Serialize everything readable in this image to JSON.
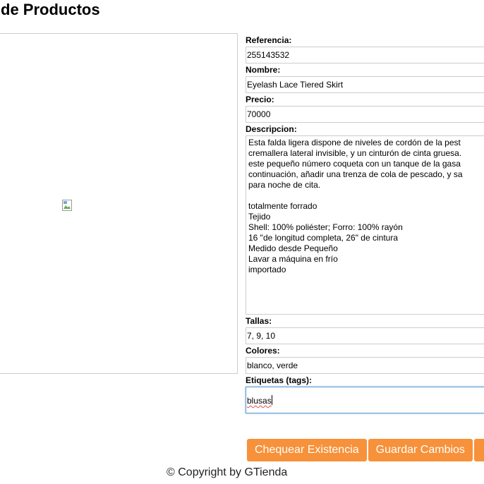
{
  "page": {
    "title": "de Productos"
  },
  "image_panel": {
    "icon": "broken-image-icon"
  },
  "form": {
    "referencia": {
      "label": "Referencia:",
      "value": "255143532"
    },
    "nombre": {
      "label": "Nombre:",
      "value": "Eyelash Lace Tiered Skirt"
    },
    "precio": {
      "label": "Precio:",
      "value": "70000"
    },
    "descripcion": {
      "label": "Descripcion:",
      "value": "Esta falda ligera dispone de niveles de cordón de la pest\ncremallera lateral invisible, y un cinturón de cinta gruesa.\neste pequeño número coqueta con un tanque de la gasa\ncontinuación, añadir una trenza de cola de pescado, y sa\npara noche de cita.\n\ntotalmente forrado\nTejido\nShell: 100% poliéster; Forro: 100% rayón\n16 \"de longitud completa, 26\" de cintura\nMedido desde Pequeño\nLavar a máquina en frío\nimportado"
    },
    "tallas": {
      "label": "Tallas:",
      "value": "7, 9, 10"
    },
    "colores": {
      "label": "Colores:",
      "value": "blanco, verde"
    },
    "etiquetas": {
      "label": "Etiquetas (tags):",
      "value": "blusas"
    }
  },
  "buttons": {
    "check_stock": "Chequear Existencia",
    "save_changes": "Guardar Cambios",
    "third": ""
  },
  "footer": {
    "copyright": "© Copyright by GTienda"
  },
  "colors": {
    "button_bg": "#f7913a",
    "button_text": "#ffffff",
    "input_border": "#cccccc",
    "focus_border": "#5b9bd5"
  }
}
